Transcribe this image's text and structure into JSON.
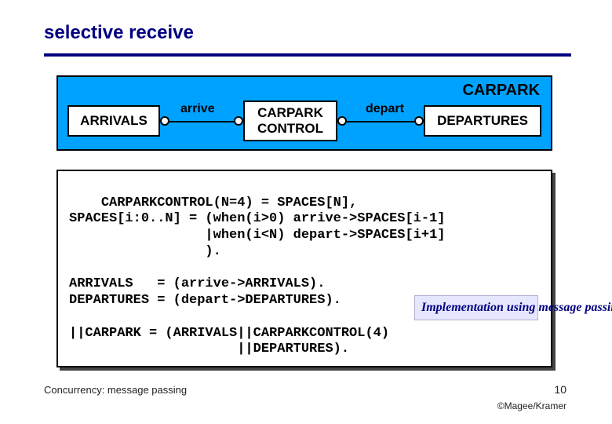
{
  "title": "selective receive",
  "diagram": {
    "label": "CARPARK",
    "boxes": {
      "arrivals": "ARRIVALS",
      "control": "CARPARK\nCONTROL",
      "departures": "DEPARTURES"
    },
    "links": {
      "arrive": "arrive",
      "depart": "depart"
    }
  },
  "code": "CARPARKCONTROL(N=4) = SPACES[N],\nSPACES[i:0..N] = (when(i>0) arrive->SPACES[i-1]\n                 |when(i<N) depart->SPACES[i+1]\n                 ).\n\nARRIVALS   = (arrive->ARRIVALS).\nDEPARTURES = (depart->DEPARTURES).\n\n||CARPARK = (ARRIVALS||CARPARKCONTROL(4)\n                     ||DEPARTURES).",
  "note": "Implementation using message passing?",
  "footer": {
    "left": "Concurrency: message passing",
    "page": "10",
    "copyright": "©Magee/Kramer"
  }
}
